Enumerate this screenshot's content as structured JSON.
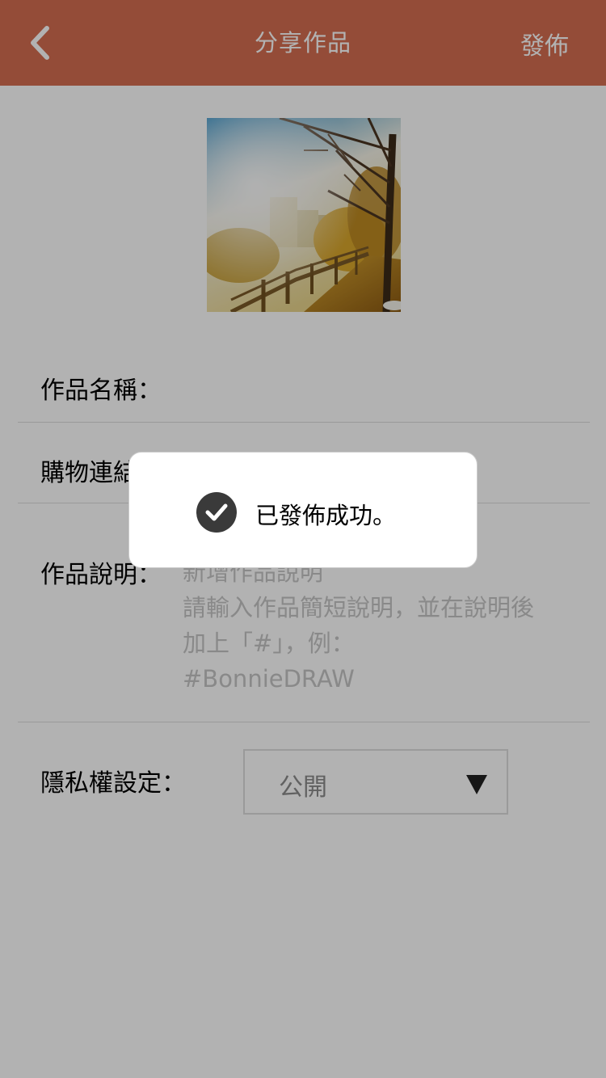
{
  "colors": {
    "navbar_bg": "#d56e51",
    "overlay": "rgba(0,0,0,0.30)",
    "toast_icon_bg": "#3a3a3a"
  },
  "navbar": {
    "back_icon": "chevron-left-icon",
    "title": "分享作品",
    "publish_label": "發佈"
  },
  "artwork": {
    "alt": "autumn tree-lined walkway with city buildings"
  },
  "form": {
    "title_label": "作品名稱：",
    "shopping_link_label": "購物連結：",
    "description_label": "作品說明：",
    "description_placeholder": "新增作品說明\n請輸入作品簡短說明，並在說明後加上「#」，例：\n#BonnieDRAW",
    "privacy_label": "隱私權設定：",
    "privacy_value": "公開",
    "privacy_dropdown_icon": "caret-down-icon"
  },
  "toast": {
    "icon": "check-circle-icon",
    "message": "已發佈成功。"
  }
}
